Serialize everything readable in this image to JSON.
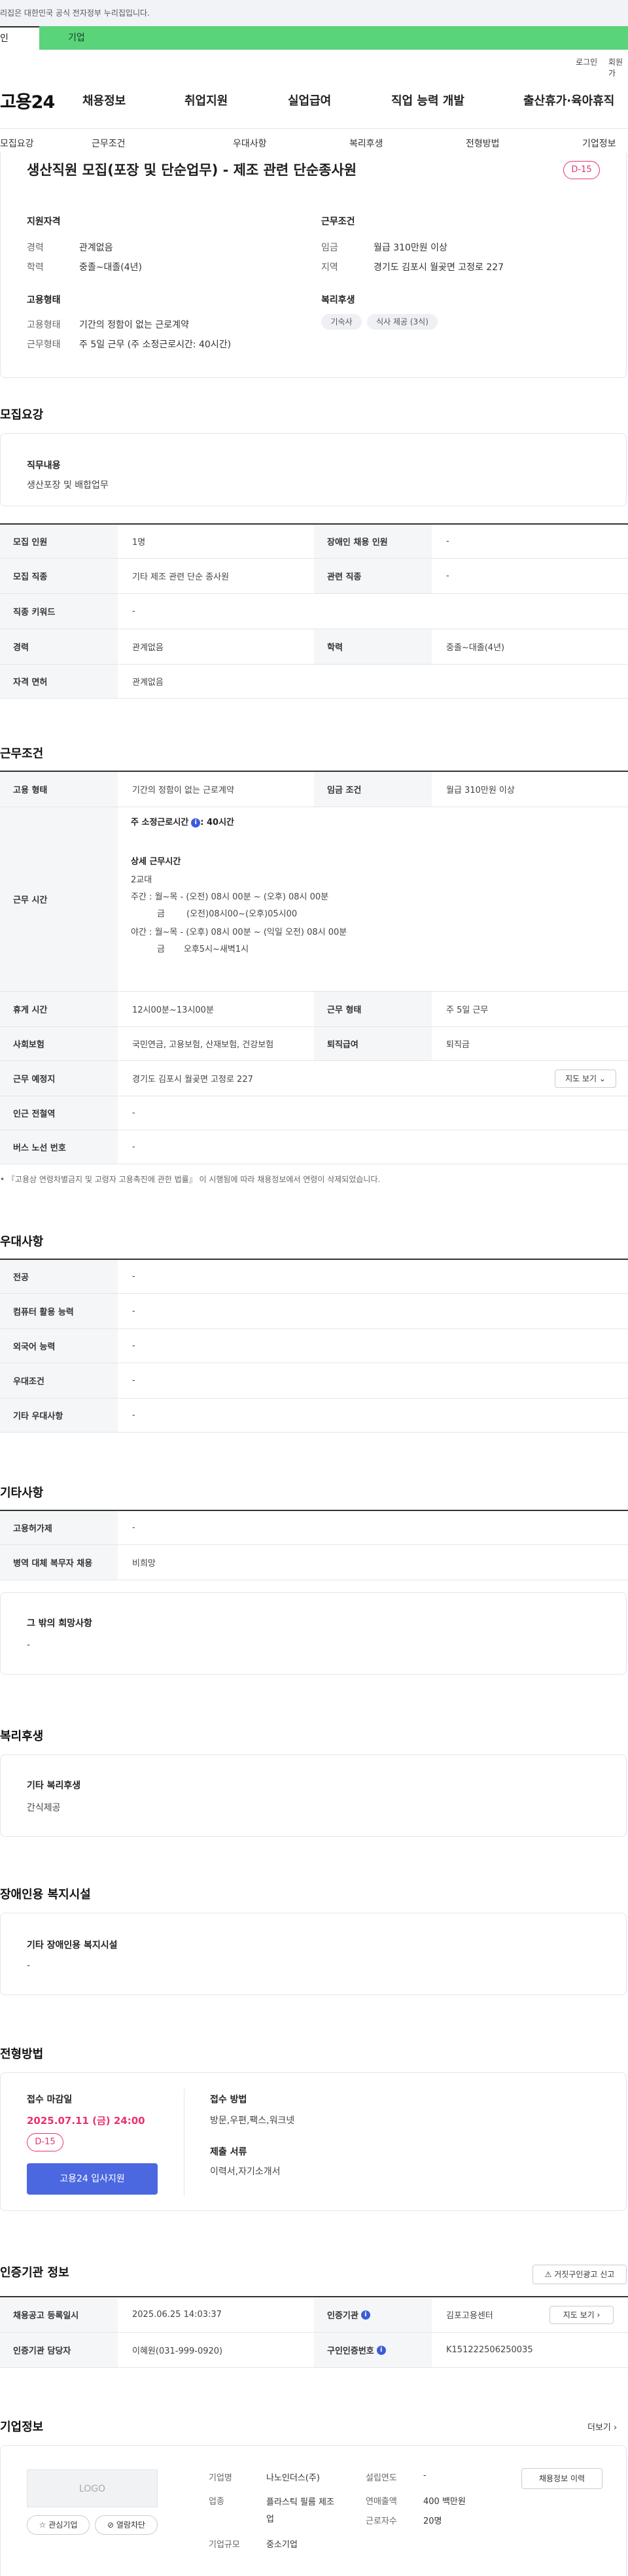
{
  "gov_banner": {
    "text": "리집은 대한민국 공식 전자정부 누리집입니다."
  },
  "tabs": {
    "individual": "인",
    "business": "기업"
  },
  "util": {
    "login": "로그인",
    "signup": "회원가"
  },
  "header": {
    "logo": "고용24",
    "gnb": [
      "채용정보",
      "취업지원",
      "실업급여",
      "직업 능력 개발",
      "출산휴가·육아휴직"
    ]
  },
  "subnav": [
    "모집요강",
    "근무조건",
    "우대사항",
    "복리후생",
    "전형방법",
    "기업정보"
  ],
  "summary": {
    "title": "생산직원 모집(포장 및 단순업무) - 제조 관련 단순종사원",
    "dday": "D-15",
    "qualification": {
      "title": "지원자격",
      "rows": [
        {
          "label": "경력",
          "value": "관계없음"
        },
        {
          "label": "학력",
          "value": "중졸~대졸(4년)"
        }
      ]
    },
    "employment": {
      "title": "고용형태",
      "rows": [
        {
          "label": "고용형태",
          "value": "기간의 정함이 없는 근로계약"
        },
        {
          "label": "근무형태",
          "value": "주 5일 근무 (주 소정근로시간: 40시간)"
        }
      ]
    },
    "conditions": {
      "title": "근무조건",
      "rows": [
        {
          "label": "임금",
          "value": "월급 310만원 이상"
        },
        {
          "label": "지역",
          "value": "경기도 김포시 월곶면 고정로 227"
        }
      ]
    },
    "welfare": {
      "title": "복리후생",
      "chips": [
        "기숙사",
        "식사 제공 (3식)"
      ]
    }
  },
  "recruit": {
    "section_title": "모집요강",
    "job_content_label": "직무내용",
    "job_content_value": "생산포장 및 배합업무",
    "rows": {
      "count_label": "모집 인원",
      "count_value": "1명",
      "disabled_label": "장애인 채용 인원",
      "disabled_value": "-",
      "job_label": "모집 직종",
      "job_value": "기타 제조 관련 단순 종사원",
      "related_label": "관련 직종",
      "related_value": "-",
      "keyword_label": "직종 키워드",
      "keyword_value": "-",
      "career_label": "경력",
      "career_value": "관계없음",
      "edu_label": "학력",
      "edu_value": "중졸~대졸(4년)",
      "license_label": "자격 면허",
      "license_value": "관계없음"
    }
  },
  "work": {
    "section_title": "근무조건",
    "type_label": "고용 형태",
    "type_value": "기간의 정함이 없는 근로계약",
    "wage_label": "임금 조건",
    "wage_value": "월급 310만원 이상",
    "time_label": "근무 시간",
    "weekly_label": "주 소정근로시간",
    "weekly_value": ": 40시간",
    "detail_title": "상세 근무시간",
    "detail_lines": [
      "2교대",
      "주간 : 월~목 - (오전) 08시 00분 ~ (오후) 08시 00분",
      "금        (오전)08시00~(오후)05시00",
      "야간 : 월~목 - (오후) 08시 00분 ~ (익일 오전) 08시 00분",
      "금       오후5시~새벽1시"
    ],
    "break_label": "휴게 시간",
    "break_value": "12시00분~13시00분",
    "shift_label": "근무 형태",
    "shift_value": "주 5일 근무",
    "insurance_label": "사회보험",
    "insurance_value": "국민연금, 고용보험, 산재보험, 건강보험",
    "severance_label": "퇴직급여",
    "severance_value": "퇴직금",
    "place_label": "근무 예정지",
    "place_value": "경기도 김포시 월곶면 고정로 227",
    "map_button": "지도 보기",
    "subway_label": "인근 전철역",
    "subway_value": "-",
    "bus_label": "버스 노선 번호",
    "bus_value": "-",
    "note": "『고용상 연령차별금지 및 고령자 고용촉진에 관한 법률』 이 시행됨에 따라 채용정보에서 연령이 삭제되었습니다."
  },
  "preference": {
    "section_title": "우대사항",
    "rows": [
      {
        "label": "전공",
        "value": "-"
      },
      {
        "label": "컴퓨터 활용 능력",
        "value": "-"
      },
      {
        "label": "외국어 능력",
        "value": "-"
      },
      {
        "label": "우대조건",
        "value": "-"
      },
      {
        "label": "기타 우대사항",
        "value": "-"
      }
    ]
  },
  "etc": {
    "section_title": "기타사항",
    "rows": [
      {
        "label": "고용허가제",
        "value": "-"
      },
      {
        "label": "병역 대체 복무자 채용",
        "value": "비희망"
      }
    ],
    "other_label": "그 밖의 희망사항",
    "other_value": "-"
  },
  "welfare_section": {
    "section_title": "복리후생",
    "label": "기타 복리후생",
    "value": "간식제공"
  },
  "disabled_facility": {
    "section_title": "장애인용 복지시설",
    "label": "기타 장애인용 복지시설",
    "value": "-"
  },
  "selection": {
    "section_title": "전형방법",
    "deadline_label": "접수 마감일",
    "deadline_value": "2025.07.11 (금) 24:00",
    "dday": "D-15",
    "apply_button": "고용24 입사지원",
    "method_label": "접수 방법",
    "method_value": "방문,우편,팩스,워크넷",
    "docs_label": "제출 서류",
    "docs_value": "이력서,자기소개서"
  },
  "agency": {
    "section_title": "인증기관 정보",
    "report_button": "거짓구인광고 신고",
    "reg_label": "채용공고 등록일시",
    "reg_value": "2025.06.25 14:03:37",
    "agency_label": "인증기관",
    "agency_value": "김포고용센터",
    "map_button": "지도 보기",
    "manager_label": "인증기관 담당자",
    "manager_value": "이혜원(031-999-0920)",
    "number_label": "구인인증번호",
    "number_value": "K151222506250035"
  },
  "company": {
    "section_title": "기업정보",
    "more": "더보기",
    "logo_placeholder": "LOGO",
    "interest_button": "관심기업",
    "block_button": "열람차단",
    "name_label": "기업명",
    "name_value": "나노인더스(주)",
    "industry_label": "업종",
    "industry_value": "플라스틱 필름 제조업",
    "size_label": "기업규모",
    "size_value": "중소기업",
    "founded_label": "설립연도",
    "founded_value": "-",
    "sales_label": "연매출액",
    "sales_value": "400 백만원",
    "employees_label": "근로자수",
    "employees_value": "20명",
    "history_button": "채용정보 이력"
  }
}
